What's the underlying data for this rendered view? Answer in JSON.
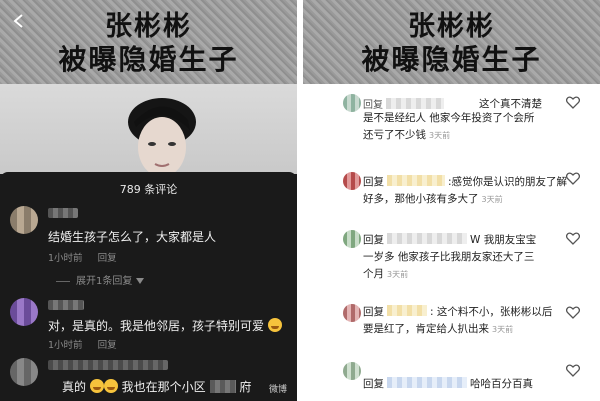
{
  "banner": {
    "line1": "张彬彬",
    "line2": "被曝隐婚生子"
  },
  "left": {
    "sheet_title": "789 条评论",
    "comments": [
      {
        "text": "结婚生孩子怎么了，大家都是人",
        "time": "1小时前",
        "reply": "回复"
      },
      {
        "text": "对，是真的。我是他邻居，孩子特别可爱",
        "time": "1小时前",
        "reply": "回复"
      }
    ],
    "expand_label": "展开1条回复",
    "third_comment_prefix": "真的",
    "third_comment_middle": "我也在那个小区",
    "third_comment_suffix": "府",
    "watermark": "微博"
  },
  "right": {
    "comments": [
      {
        "reply": "回复",
        "lines": [
          "这个真不清楚",
          "是不是经纪人  他家今年投资了个会所",
          "还亏了不少钱"
        ],
        "time": "3天前"
      },
      {
        "reply": "回复",
        "lines": [
          ":感觉你是认识的朋友了解",
          "好多，那他小孩有多大了"
        ],
        "time": "3天前"
      },
      {
        "reply": "回复",
        "lines": [
          "W 我朋友宝宝",
          "一岁多 他家孩子比我朋友家还大了三",
          "个月"
        ],
        "time": "3天前"
      },
      {
        "reply": "回复",
        "lines": [
          ": 这个料不小，张彬彬以后",
          "要是红了，肯定给人扒出来"
        ],
        "time": "3天前"
      },
      {
        "reply": "回复",
        "lines": [
          "哈哈百分百真"
        ],
        "time": ""
      }
    ]
  },
  "icons": {
    "back": "chevron-left-icon",
    "like": "heart-outline-icon",
    "expand": "caret-down-icon",
    "emoji": "laughing-emoji-icon"
  },
  "colors": {
    "sheet_bg": "#1a1a1a",
    "accent": "#f6c33c"
  }
}
